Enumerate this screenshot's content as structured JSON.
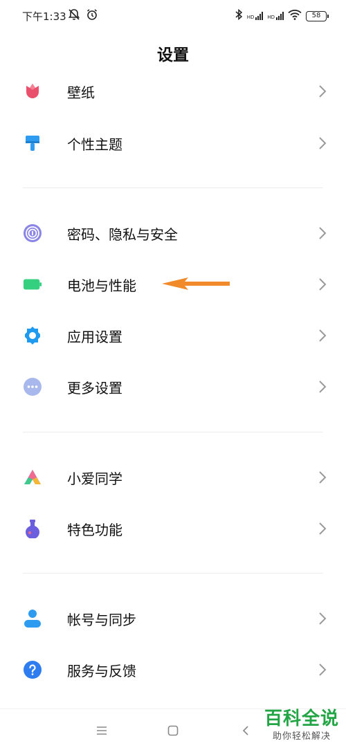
{
  "status_bar": {
    "time": "下午1:33",
    "battery_level": "58",
    "sim1_label": "HD",
    "sim2_label": "HD",
    "icons": [
      "notifications-off-icon",
      "alarm-icon",
      "bluetooth-icon",
      "signal-icon",
      "signal-icon",
      "wifi-icon",
      "battery-icon"
    ]
  },
  "header": {
    "title": "设置"
  },
  "groups": {
    "personalization": [
      {
        "label": "壁纸",
        "icon": "wallpaper-tulip-icon",
        "color": "#e8506b"
      },
      {
        "label": "个性主题",
        "icon": "theme-brush-icon",
        "color": "#2d9cf0"
      }
    ],
    "system": [
      {
        "label": "密码、隐私与安全",
        "icon": "fingerprint-icon",
        "color": "#7d7de0"
      },
      {
        "label": "电池与性能",
        "icon": "battery-icon",
        "color": "#35d07f"
      },
      {
        "label": "应用设置",
        "icon": "gear-icon",
        "color": "#1e9bf0"
      },
      {
        "label": "更多设置",
        "icon": "more-dots-icon",
        "color": "#a9b8ec"
      }
    ],
    "features": [
      {
        "label": "小爱同学",
        "icon": "xiaoai-icon",
        "color": "#3d8ef5"
      },
      {
        "label": "特色功能",
        "icon": "flask-icon",
        "color": "#6b5fe0"
      }
    ],
    "account": [
      {
        "label": "帐号与同步",
        "icon": "user-icon",
        "color": "#2d9cf0"
      },
      {
        "label": "服务与反馈",
        "icon": "help-icon",
        "color": "#2d7df0"
      }
    ]
  },
  "annotation": {
    "icon": "arrow-left-icon",
    "color": "#f08a2b"
  },
  "nav_bar": {
    "icons": [
      "menu-icon",
      "home-icon",
      "back-icon"
    ]
  },
  "watermark": {
    "main": "百科全说",
    "sub": "助你轻松解决"
  }
}
